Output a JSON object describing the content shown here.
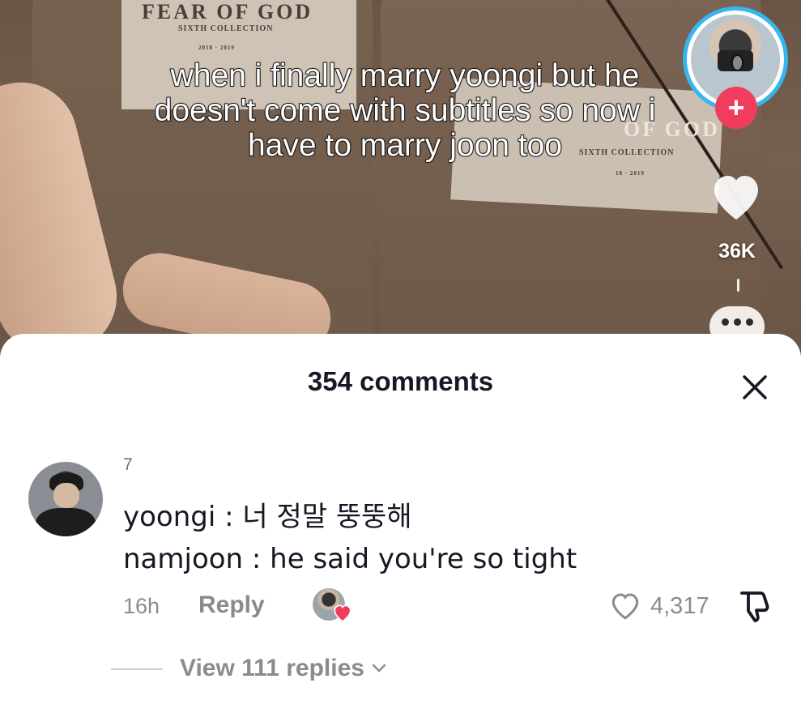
{
  "video": {
    "caption": "when i finally marry yoongi but he doesn't come with subtitles so now i have to marry joon too",
    "shirt_print": {
      "brand_left": "FEAR OF GOD",
      "collection_left": "SIXTH COLLECTION",
      "years_left": "2018 · 2019",
      "brand_right": "OF GOD",
      "collection_right": "SIXTH COLLECTION",
      "years_right": "18 · 2019"
    }
  },
  "rail": {
    "follow_symbol": "+",
    "like_count": "36K",
    "icons": [
      "profile-avatar",
      "plus-icon",
      "heart-icon",
      "more-icon"
    ],
    "colors": {
      "ring": "#36b6f0",
      "follow": "#f23c5d"
    }
  },
  "comments_sheet": {
    "title": "354 comments",
    "close_symbol": "✕",
    "comment": {
      "username": "7",
      "lines": [
        "yoongi : 너 정말 뚱뚱해",
        "namjoon : he said you're so tight"
      ],
      "time": "16h",
      "reply_label": "Reply",
      "like_count": "4,317",
      "liked_by_creator": true,
      "view_replies_label": "View 111 replies"
    }
  }
}
